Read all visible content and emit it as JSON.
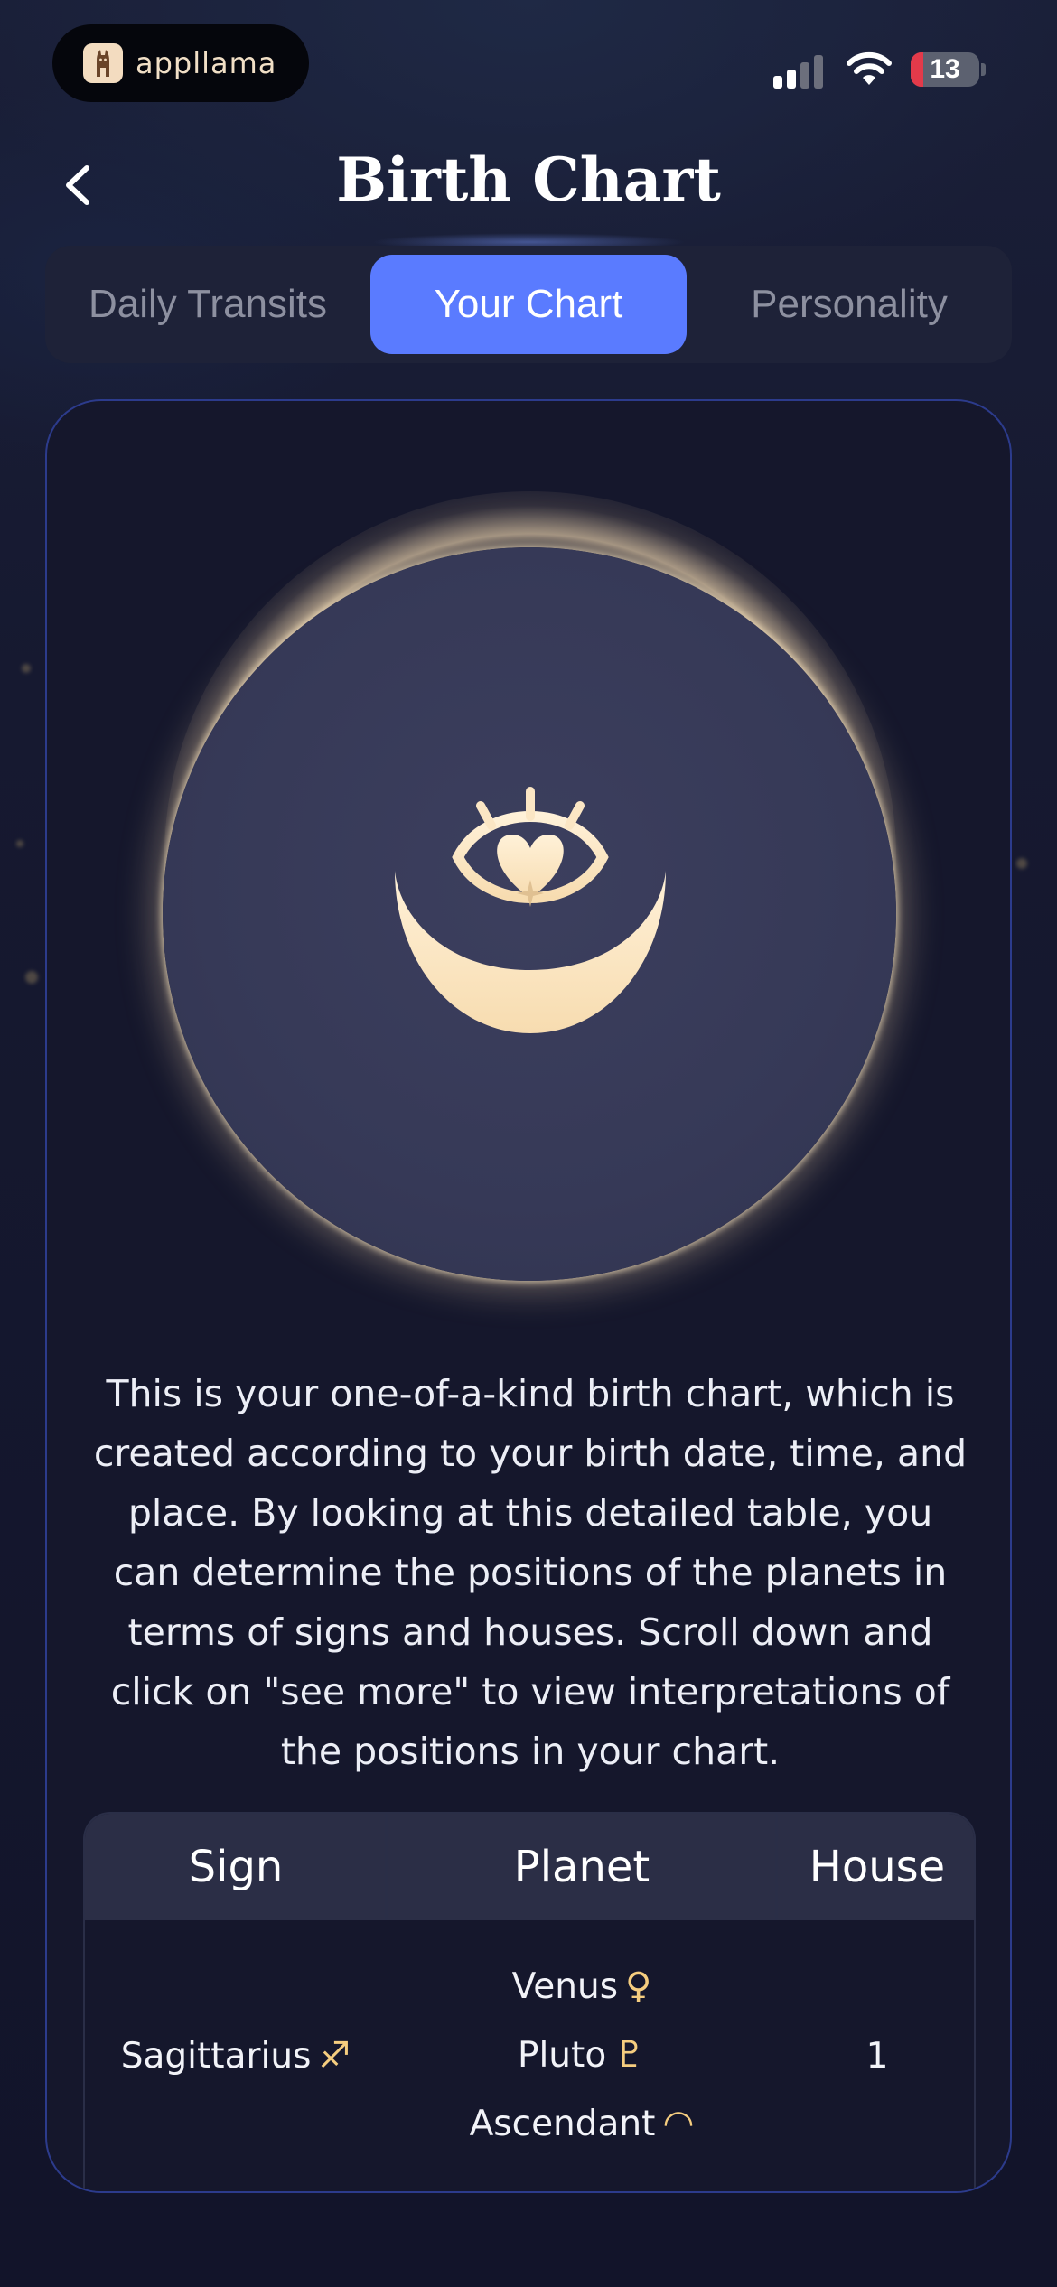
{
  "status_bar": {
    "app_badge_label": "appllama",
    "battery_level": "13"
  },
  "header": {
    "title": "Birth Chart"
  },
  "tabs": [
    {
      "label": "Daily Transits",
      "active": false
    },
    {
      "label": "Your Chart",
      "active": true
    },
    {
      "label": "Personality",
      "active": false
    }
  ],
  "emblem": {
    "icon": "moon-eye-heart-icon"
  },
  "description": "This is your one-of-a-kind birth chart, which is created according to your birth date, time, and place. By looking at this detailed table, you can determine the positions of the planets in terms of signs and houses. Scroll down and click on \"see more\" to view interpretations of the positions in your chart.",
  "table": {
    "headers": [
      "Sign",
      "Planet",
      "House"
    ],
    "rows": [
      {
        "sign": "Sagittarius",
        "sign_glyph": "♐",
        "planets": [
          {
            "name": "Venus",
            "glyph": "♀"
          },
          {
            "name": "Pluto",
            "glyph": "♇"
          },
          {
            "name": "Ascendant",
            "glyph": "◠"
          }
        ],
        "house": "1"
      }
    ]
  },
  "colors": {
    "accent": "#5a7bff",
    "gold": "#f5cd7f",
    "card_border": "#2c3b8c",
    "background": "#141628"
  }
}
